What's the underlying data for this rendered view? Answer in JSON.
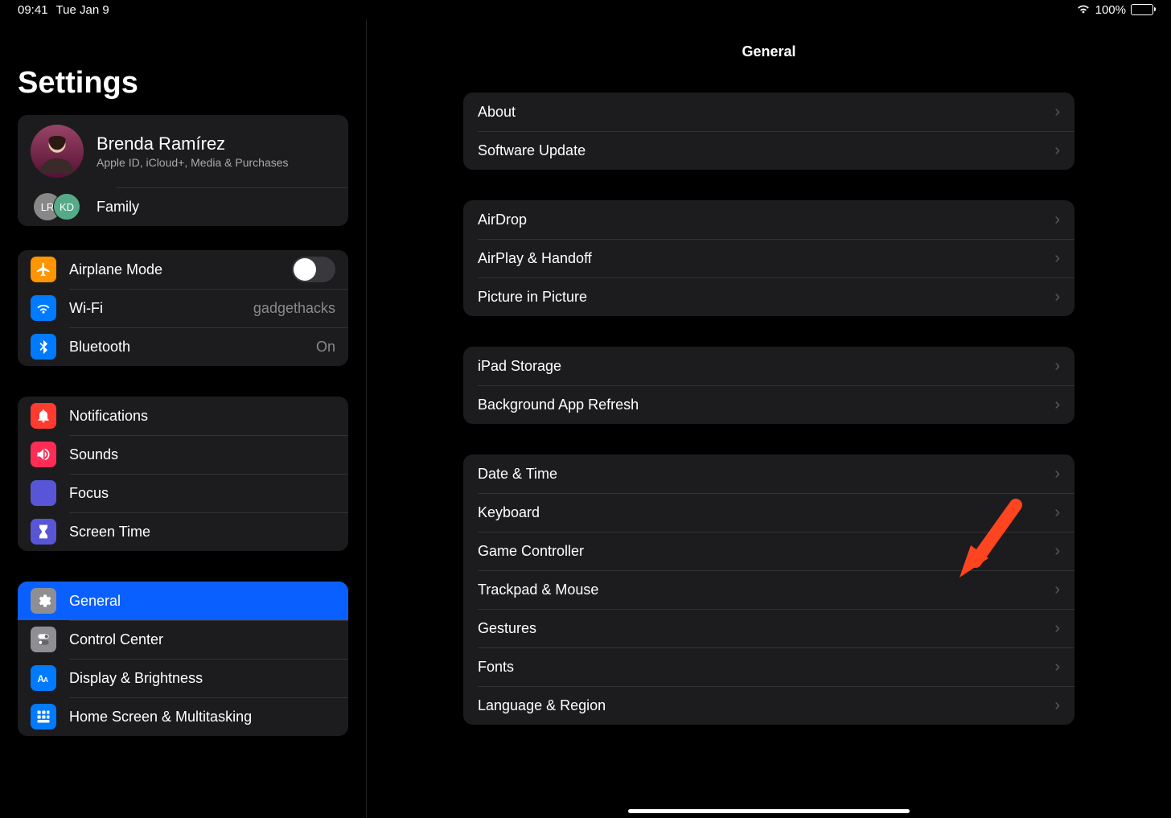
{
  "status": {
    "time": "09:41",
    "date": "Tue Jan 9",
    "battery_pct": "100%"
  },
  "sidebar": {
    "title": "Settings",
    "profile": {
      "name": "Brenda Ramírez",
      "subtitle": "Apple ID, iCloud+, Media & Purchases",
      "family_label": "Family",
      "family_initials": [
        "LR",
        "KD"
      ]
    },
    "group_connectivity": [
      {
        "id": "airplane",
        "label": "Airplane Mode",
        "icon": "airplane",
        "bg": "bg-orange",
        "control": "toggle"
      },
      {
        "id": "wifi",
        "label": "Wi-Fi",
        "icon": "wifi",
        "bg": "bg-blue",
        "value": "gadgethacks"
      },
      {
        "id": "bluetooth",
        "label": "Bluetooth",
        "icon": "bluetooth",
        "bg": "bg-blue",
        "value": "On"
      }
    ],
    "group_alerts": [
      {
        "id": "notifications",
        "label": "Notifications",
        "icon": "bell",
        "bg": "bg-red"
      },
      {
        "id": "sounds",
        "label": "Sounds",
        "icon": "speaker",
        "bg": "bg-pink"
      },
      {
        "id": "focus",
        "label": "Focus",
        "icon": "moon",
        "bg": "bg-indigo"
      },
      {
        "id": "screentime",
        "label": "Screen Time",
        "icon": "hourglass",
        "bg": "bg-indigo"
      }
    ],
    "group_system": [
      {
        "id": "general",
        "label": "General",
        "icon": "gear",
        "bg": "bg-gray",
        "selected": true
      },
      {
        "id": "controlcenter",
        "label": "Control Center",
        "icon": "sliders",
        "bg": "bg-gray"
      },
      {
        "id": "display",
        "label": "Display & Brightness",
        "icon": "textsize",
        "bg": "bg-blue"
      },
      {
        "id": "homescreen",
        "label": "Home Screen & Multitasking",
        "icon": "grid",
        "bg": "bg-blue"
      }
    ]
  },
  "main": {
    "title": "General",
    "groups": [
      [
        {
          "id": "about",
          "label": "About"
        },
        {
          "id": "software-update",
          "label": "Software Update"
        }
      ],
      [
        {
          "id": "airdrop",
          "label": "AirDrop"
        },
        {
          "id": "airplay",
          "label": "AirPlay & Handoff"
        },
        {
          "id": "pip",
          "label": "Picture in Picture"
        }
      ],
      [
        {
          "id": "storage",
          "label": "iPad Storage"
        },
        {
          "id": "bg-refresh",
          "label": "Background App Refresh"
        }
      ],
      [
        {
          "id": "datetime",
          "label": "Date & Time"
        },
        {
          "id": "keyboard",
          "label": "Keyboard"
        },
        {
          "id": "gamecontroller",
          "label": "Game Controller"
        },
        {
          "id": "trackpad",
          "label": "Trackpad & Mouse"
        },
        {
          "id": "gestures",
          "label": "Gestures"
        },
        {
          "id": "fonts",
          "label": "Fonts"
        },
        {
          "id": "language",
          "label": "Language & Region"
        }
      ]
    ]
  }
}
